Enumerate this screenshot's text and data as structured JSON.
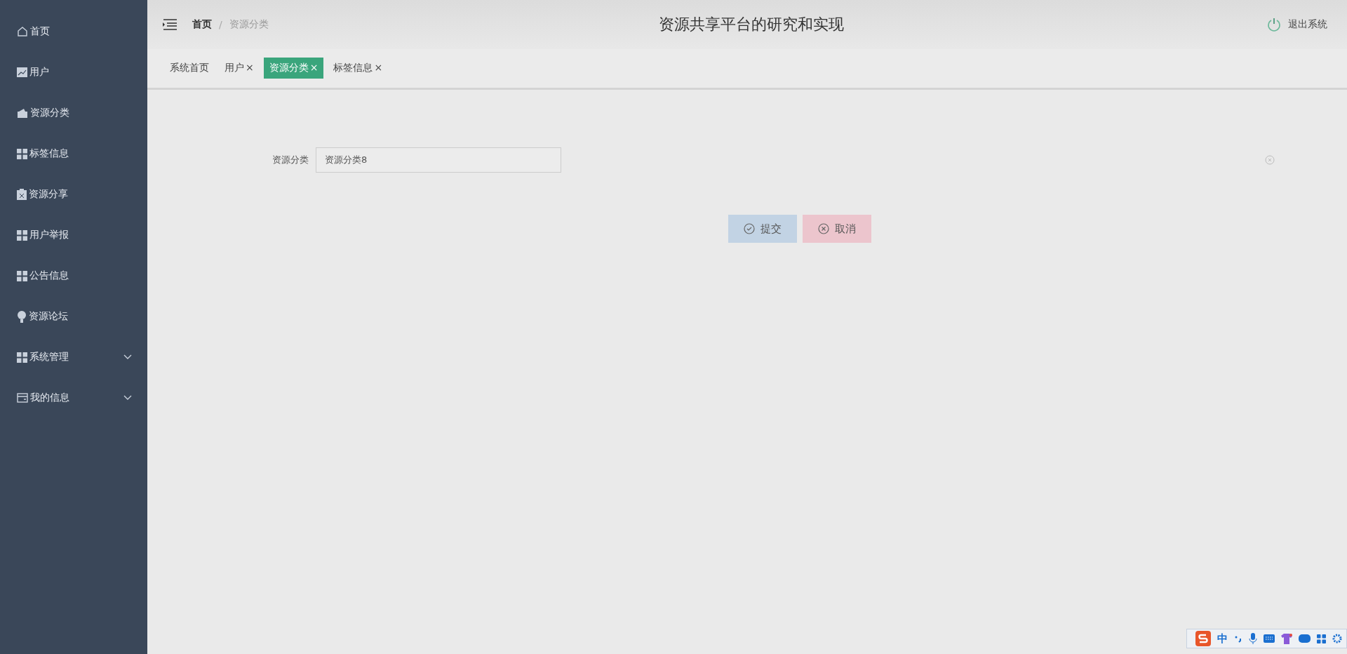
{
  "sidebar": {
    "items": [
      {
        "label": "首页",
        "kind": "link"
      },
      {
        "label": "用户",
        "kind": "link"
      },
      {
        "label": "资源分类",
        "kind": "link"
      },
      {
        "label": "标签信息",
        "kind": "link"
      },
      {
        "label": "资源分享",
        "kind": "link"
      },
      {
        "label": "用户举报",
        "kind": "link"
      },
      {
        "label": "公告信息",
        "kind": "link"
      },
      {
        "label": "资源论坛",
        "kind": "link"
      },
      {
        "label": "系统管理",
        "kind": "group"
      },
      {
        "label": "我的信息",
        "kind": "group"
      }
    ]
  },
  "header": {
    "breadcrumb": [
      "首页",
      "资源分类"
    ],
    "breadcrumb_separator": "/",
    "title": "资源共享平台的研究和实现",
    "logout": "退出系统"
  },
  "tabs": [
    {
      "label": "系统首页",
      "selected": false
    },
    {
      "label": "用户",
      "selected": false,
      "close": "×"
    },
    {
      "label": "资源分类",
      "selected": true,
      "close": "×"
    },
    {
      "label": "标签信息",
      "selected": false,
      "close": "×"
    }
  ],
  "form": {
    "fields": [
      {
        "label": "资源分类",
        "value": "资源分类8"
      }
    ],
    "buttons": [
      {
        "label": "提交",
        "kind": "submit"
      },
      {
        "label": "取消",
        "kind": "cancel"
      }
    ]
  },
  "ime_toolbar": {
    "mode": "中"
  }
}
